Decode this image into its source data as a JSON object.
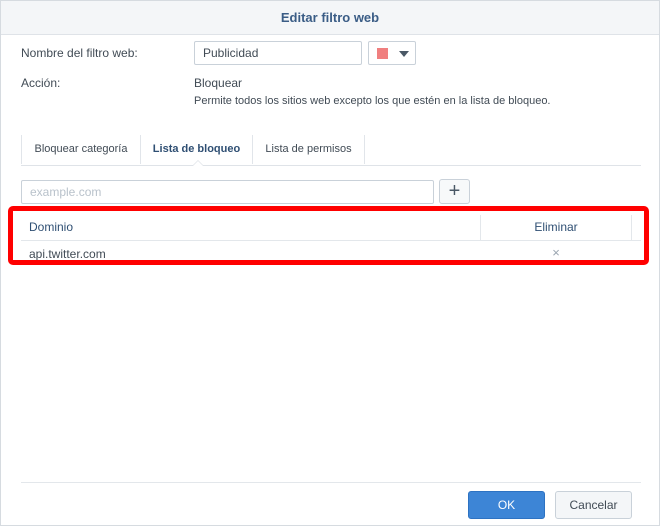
{
  "dialog": {
    "title": "Editar filtro web"
  },
  "form": {
    "name_label": "Nombre del filtro web:",
    "name_value": "Publicidad",
    "color_value": "#f07f7f",
    "action_label": "Acción:",
    "action_value": "Bloquear",
    "action_description": "Permite todos los sitios web excepto los que estén en la lista de bloqueo."
  },
  "tabs": [
    {
      "label": "Bloquear categoría",
      "active": false
    },
    {
      "label": "Lista de bloqueo",
      "active": true
    },
    {
      "label": "Lista de permisos",
      "active": false
    }
  ],
  "domain_input": {
    "placeholder": "example.com"
  },
  "grid": {
    "columns": [
      "Dominio",
      "Eliminar"
    ],
    "rows": [
      {
        "domain": "api.twitter.com",
        "delete_glyph": "×"
      }
    ]
  },
  "footer": {
    "ok_label": "OK",
    "cancel_label": "Cancelar"
  },
  "colors": {
    "title": "#3b5d86",
    "primary_button": "#3d85d6",
    "highlight": "#ff0000"
  }
}
